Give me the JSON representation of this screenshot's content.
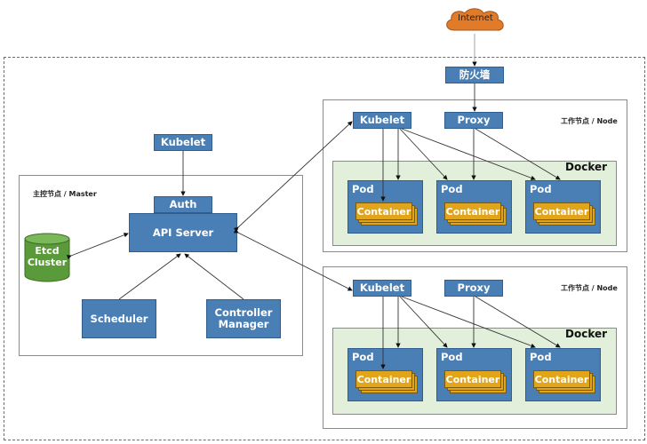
{
  "internet": {
    "label": "Internet",
    "color": "#e07b2a"
  },
  "firewall": {
    "label": "防火墙"
  },
  "master": {
    "title": "主控节点 / Master",
    "kubelet": "Kubelet",
    "auth": "Auth",
    "api_server": "API Server",
    "etcd": "Etcd Cluster",
    "scheduler": "Scheduler",
    "controller_manager": "Controller Manager"
  },
  "nodes": [
    {
      "title": "工作节点 / Node",
      "kubelet": "Kubelet",
      "proxy": "Proxy",
      "docker": "Docker",
      "pods": [
        {
          "label": "Pod",
          "container": "Container"
        },
        {
          "label": "Pod",
          "container": "Container"
        },
        {
          "label": "Pod",
          "container": "Container"
        }
      ]
    },
    {
      "title": "工作节点 / Node",
      "kubelet": "Kubelet",
      "proxy": "Proxy",
      "docker": "Docker",
      "pods": [
        {
          "label": "Pod",
          "container": "Container"
        },
        {
          "label": "Pod",
          "container": "Container"
        },
        {
          "label": "Pod",
          "container": "Container"
        }
      ]
    }
  ],
  "colors": {
    "component_blue": "#4a7fb5",
    "container_gold": "#e2a51a",
    "docker_bg": "#e2efda",
    "etcd_green": "#5a9a3a"
  }
}
